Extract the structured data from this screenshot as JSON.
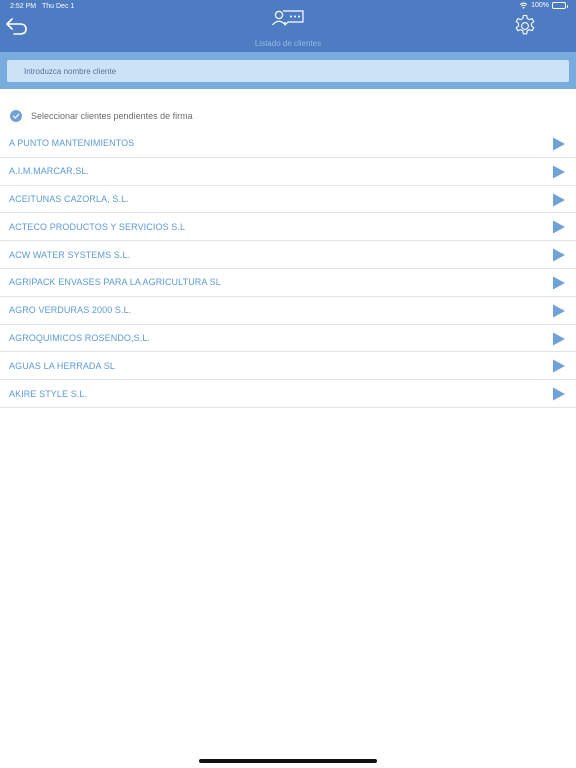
{
  "status_bar": {
    "time": "2:52 PM",
    "date": "Thu Dec 1",
    "battery": "100%"
  },
  "header": {
    "title": "Listado de clientes",
    "title_icon": "clients-list-icon",
    "back_icon": "back-arrow-icon",
    "settings_icon": "gear-icon"
  },
  "search": {
    "placeholder": "Introduzca nombre cliente",
    "value": ""
  },
  "filter": {
    "label": "Seleccionar clientes pendientes de firma",
    "checked": true
  },
  "clients": [
    {
      "name": "A PUNTO MANTENIMIENTOS"
    },
    {
      "name": "A.I.M.MARCAR,SL."
    },
    {
      "name": "ACEITUNAS CAZORLA, S.L."
    },
    {
      "name": "ACTECO PRODUCTOS Y SERVICIOS S.L"
    },
    {
      "name": "ACW WATER SYSTEMS S.L."
    },
    {
      "name": "AGRIPACK ENVASES PARA LA AGRICULTURA SL"
    },
    {
      "name": "AGRO VERDURAS 2000 S.L."
    },
    {
      "name": "AGROQUIMICOS ROSENDO,S.L."
    },
    {
      "name": "AGUAS LA HERRADA SL"
    },
    {
      "name": "AKIRE STYLE S.L."
    }
  ],
  "colors": {
    "header": "#4d7cc3",
    "search_band": "#78acdf",
    "search_field": "#cce2f6",
    "client_text": "#5b9ad6",
    "arrow": "#6fa3d7"
  }
}
